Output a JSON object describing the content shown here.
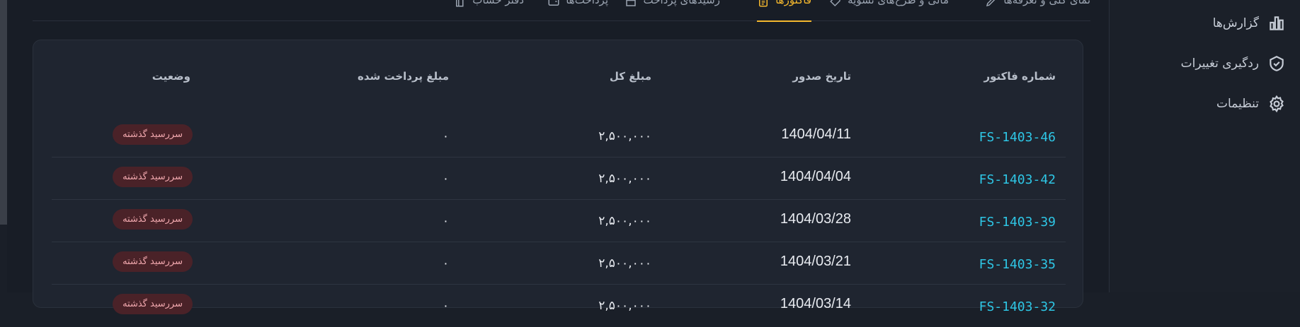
{
  "tabs": [
    {
      "label": "نمای کلی و تعرفه‌ها",
      "icon": "pencil-icon",
      "active": false
    },
    {
      "label": "مالی و طرح‌های تسویه",
      "icon": "tag-icon",
      "active": false
    },
    {
      "label": "فاکتورها",
      "icon": "document-icon",
      "active": true
    },
    {
      "label": "رسیدهای پرداخت",
      "icon": "receipt-icon",
      "active": false
    },
    {
      "label": "پرداخت‌ها",
      "icon": "wallet-icon",
      "active": false
    },
    {
      "label": "دفتر حساب",
      "icon": "ledger-icon",
      "active": false
    }
  ],
  "table": {
    "headers": {
      "invoice_no": "شماره فاکتور",
      "issue_date": "تاریخ صدور",
      "total": "مبلغ کل",
      "paid": "مبلغ پرداخت شده",
      "status": "وضعیت"
    },
    "rows": [
      {
        "invoice_no": "FS-1403-46",
        "issue_date": "1404/04/11",
        "total": "۲,۵۰۰,۰۰۰",
        "paid": "۰",
        "status": "سررسید گذشته"
      },
      {
        "invoice_no": "FS-1403-42",
        "issue_date": "1404/04/04",
        "total": "۲,۵۰۰,۰۰۰",
        "paid": "۰",
        "status": "سررسید گذشته"
      },
      {
        "invoice_no": "FS-1403-39",
        "issue_date": "1404/03/28",
        "total": "۲,۵۰۰,۰۰۰",
        "paid": "۰",
        "status": "سررسید گذشته"
      },
      {
        "invoice_no": "FS-1403-35",
        "issue_date": "1404/03/21",
        "total": "۲,۵۰۰,۰۰۰",
        "paid": "۰",
        "status": "سررسید گذشته"
      },
      {
        "invoice_no": "FS-1403-32",
        "issue_date": "1404/03/14",
        "total": "۲,۵۰۰,۰۰۰",
        "paid": "۰",
        "status": "سررسید گذشته"
      }
    ]
  },
  "sidebar": {
    "items": [
      {
        "label": "گزارش‌ها",
        "icon": "bar-chart-icon"
      },
      {
        "label": "ردگیری تغییرات",
        "icon": "shield-check-icon"
      },
      {
        "label": "تنظیمات",
        "icon": "gear-icon"
      }
    ]
  },
  "colors": {
    "accent": "#f5b82e",
    "link": "#2ec7e6",
    "overdue_bg": "#4a2228",
    "overdue_text": "#f0a7ad"
  }
}
